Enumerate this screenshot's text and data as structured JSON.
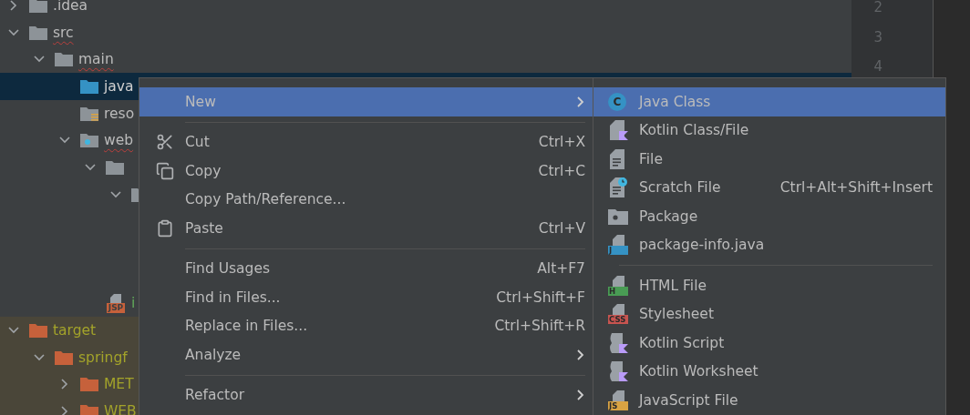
{
  "project_tree": {
    "items": [
      {
        "kind": "folder",
        "label": ".idea",
        "expanded": false,
        "selected": false,
        "misspelled": false
      },
      {
        "kind": "folder",
        "label": "src",
        "expanded": true,
        "selected": false,
        "misspelled": true,
        "children": [
          {
            "kind": "folder",
            "label": "main",
            "expanded": true,
            "selected": false,
            "misspelled": true,
            "children": [
              {
                "kind": "source_folder",
                "label": "java",
                "selected": true,
                "misspelled": false
              },
              {
                "kind": "resources_folder",
                "label": "reso",
                "selected": false,
                "misspelled": false
              },
              {
                "kind": "web_folder",
                "label": "web",
                "expanded": true,
                "selected": false,
                "misspelled": true,
                "children": [
                  {
                    "kind": "folder",
                    "expanded": true,
                    "selected": false,
                    "children": [
                      {
                        "kind": "folder",
                        "expanded": true,
                        "selected": false
                      }
                    ]
                  },
                  {
                    "kind": "jsp_file",
                    "badge": "JSP",
                    "label": "i",
                    "selected": false,
                    "misspelled": false
                  }
                ]
              }
            ]
          }
        ]
      },
      {
        "kind": "excluded_folder",
        "label": "target",
        "expanded": true,
        "selected": false,
        "misspelled": false,
        "children": [
          {
            "kind": "excluded_folder",
            "label": "springf",
            "expanded": true,
            "selected": false,
            "misspelled": false,
            "children": [
              {
                "kind": "excluded_folder",
                "label": "MET",
                "expanded": false,
                "selected": false,
                "misspelled": false
              },
              {
                "kind": "excluded_folder",
                "label": "WEB",
                "expanded": false,
                "selected": false,
                "misspelled": false
              }
            ]
          }
        ]
      }
    ]
  },
  "editor": {
    "line_numbers": [
      "2",
      "3",
      "4"
    ]
  },
  "context_menu": {
    "items": [
      {
        "kind": "plain",
        "label": "New",
        "has_submenu": true,
        "selected": true
      },
      {
        "kind": "separator"
      },
      {
        "kind": "cut",
        "label": "Cut",
        "shortcut": "Ctrl+X",
        "has_submenu": false,
        "selected": false
      },
      {
        "kind": "copy",
        "label": "Copy",
        "shortcut": "Ctrl+C",
        "has_submenu": false,
        "selected": false
      },
      {
        "kind": "plain",
        "label": "Copy Path/Reference...",
        "has_submenu": false,
        "selected": false
      },
      {
        "kind": "paste",
        "label": "Paste",
        "shortcut": "Ctrl+V",
        "has_submenu": false,
        "selected": false
      },
      {
        "kind": "separator"
      },
      {
        "kind": "plain",
        "label": "Find Usages",
        "shortcut": "Alt+F7",
        "has_submenu": false,
        "selected": false
      },
      {
        "kind": "plain",
        "label": "Find in Files...",
        "shortcut": "Ctrl+Shift+F",
        "has_submenu": false,
        "selected": false
      },
      {
        "kind": "plain",
        "label": "Replace in Files...",
        "shortcut": "Ctrl+Shift+R",
        "has_submenu": false,
        "selected": false
      },
      {
        "kind": "plain",
        "label": "Analyze",
        "has_submenu": true,
        "selected": false
      },
      {
        "kind": "separator"
      },
      {
        "kind": "plain",
        "label": "Refactor",
        "has_submenu": true,
        "selected": false
      }
    ]
  },
  "new_submenu": {
    "items": [
      {
        "kind": "java_class",
        "badge": "C",
        "label": "Java Class",
        "selected": true
      },
      {
        "kind": "kotlin_file",
        "label": "Kotlin Class/File",
        "selected": false
      },
      {
        "kind": "file",
        "label": "File",
        "selected": false
      },
      {
        "kind": "scratch_file",
        "label": "Scratch File",
        "shortcut": "Ctrl+Alt+Shift+Insert",
        "selected": false
      },
      {
        "kind": "package",
        "label": "Package",
        "selected": false
      },
      {
        "kind": "badged_file",
        "badge": "J",
        "color": "#3592c4",
        "label": "package-info.java",
        "selected": false
      },
      {
        "kind": "separator"
      },
      {
        "kind": "badged_file",
        "badge": "H",
        "color": "#499c54",
        "label": "HTML File",
        "selected": false
      },
      {
        "kind": "badged_file",
        "badge": "CSS",
        "color": "#c75450",
        "label": "Stylesheet",
        "selected": false
      },
      {
        "kind": "kotlin_script",
        "label": "Kotlin Script",
        "selected": false
      },
      {
        "kind": "kotlin_script",
        "label": "Kotlin Worksheet",
        "selected": false
      },
      {
        "kind": "badged_file",
        "badge": "JS",
        "color": "#d9a343",
        "label": "JavaScript File",
        "selected": false
      }
    ]
  }
}
